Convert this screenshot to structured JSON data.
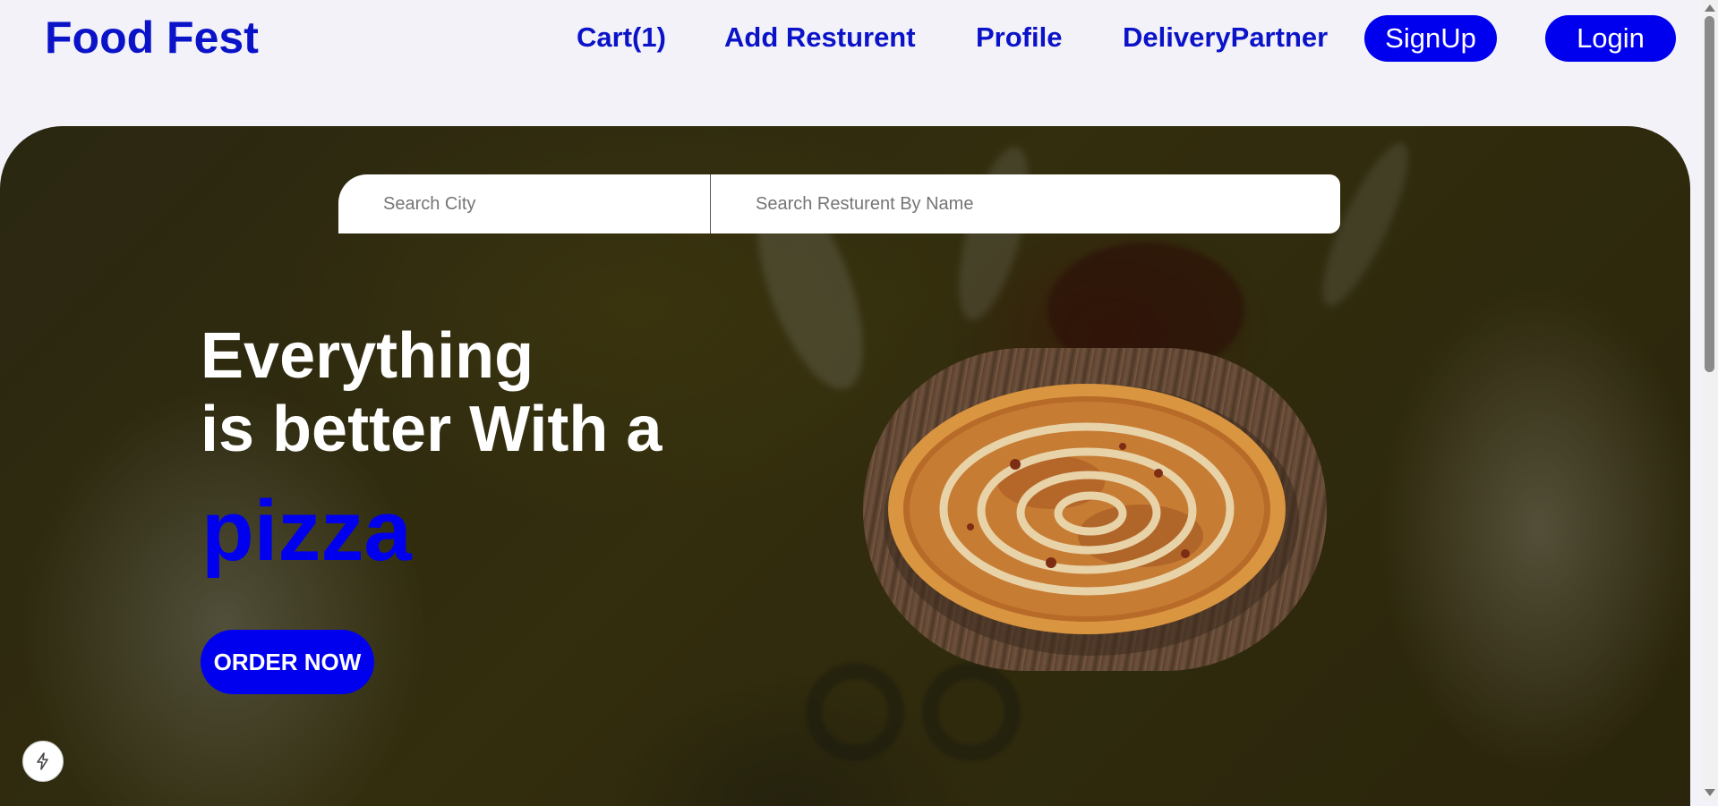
{
  "header": {
    "brand": "Food Fest",
    "nav": {
      "cart": "Cart(1)",
      "add_restaurant": "Add Resturent",
      "profile": "Profile",
      "delivery_partner": "DeliveryPartner"
    },
    "signup_label": "SignUp",
    "login_label": "Login"
  },
  "hero": {
    "search": {
      "city_placeholder": "Search City",
      "name_placeholder": "Search Resturent By Name"
    },
    "headline_line1": "Everything",
    "headline_line2": "is better With a",
    "headline_accent": "pizza",
    "cta_label": "ORDER NOW",
    "image_icon": "pizza-photo"
  },
  "badge": {
    "icon": "lightning-icon"
  },
  "colors": {
    "brand": "#0b13c9",
    "accent": "#0000ee",
    "background": "#f3f2f8",
    "text_on_dark": "#ffffff"
  }
}
